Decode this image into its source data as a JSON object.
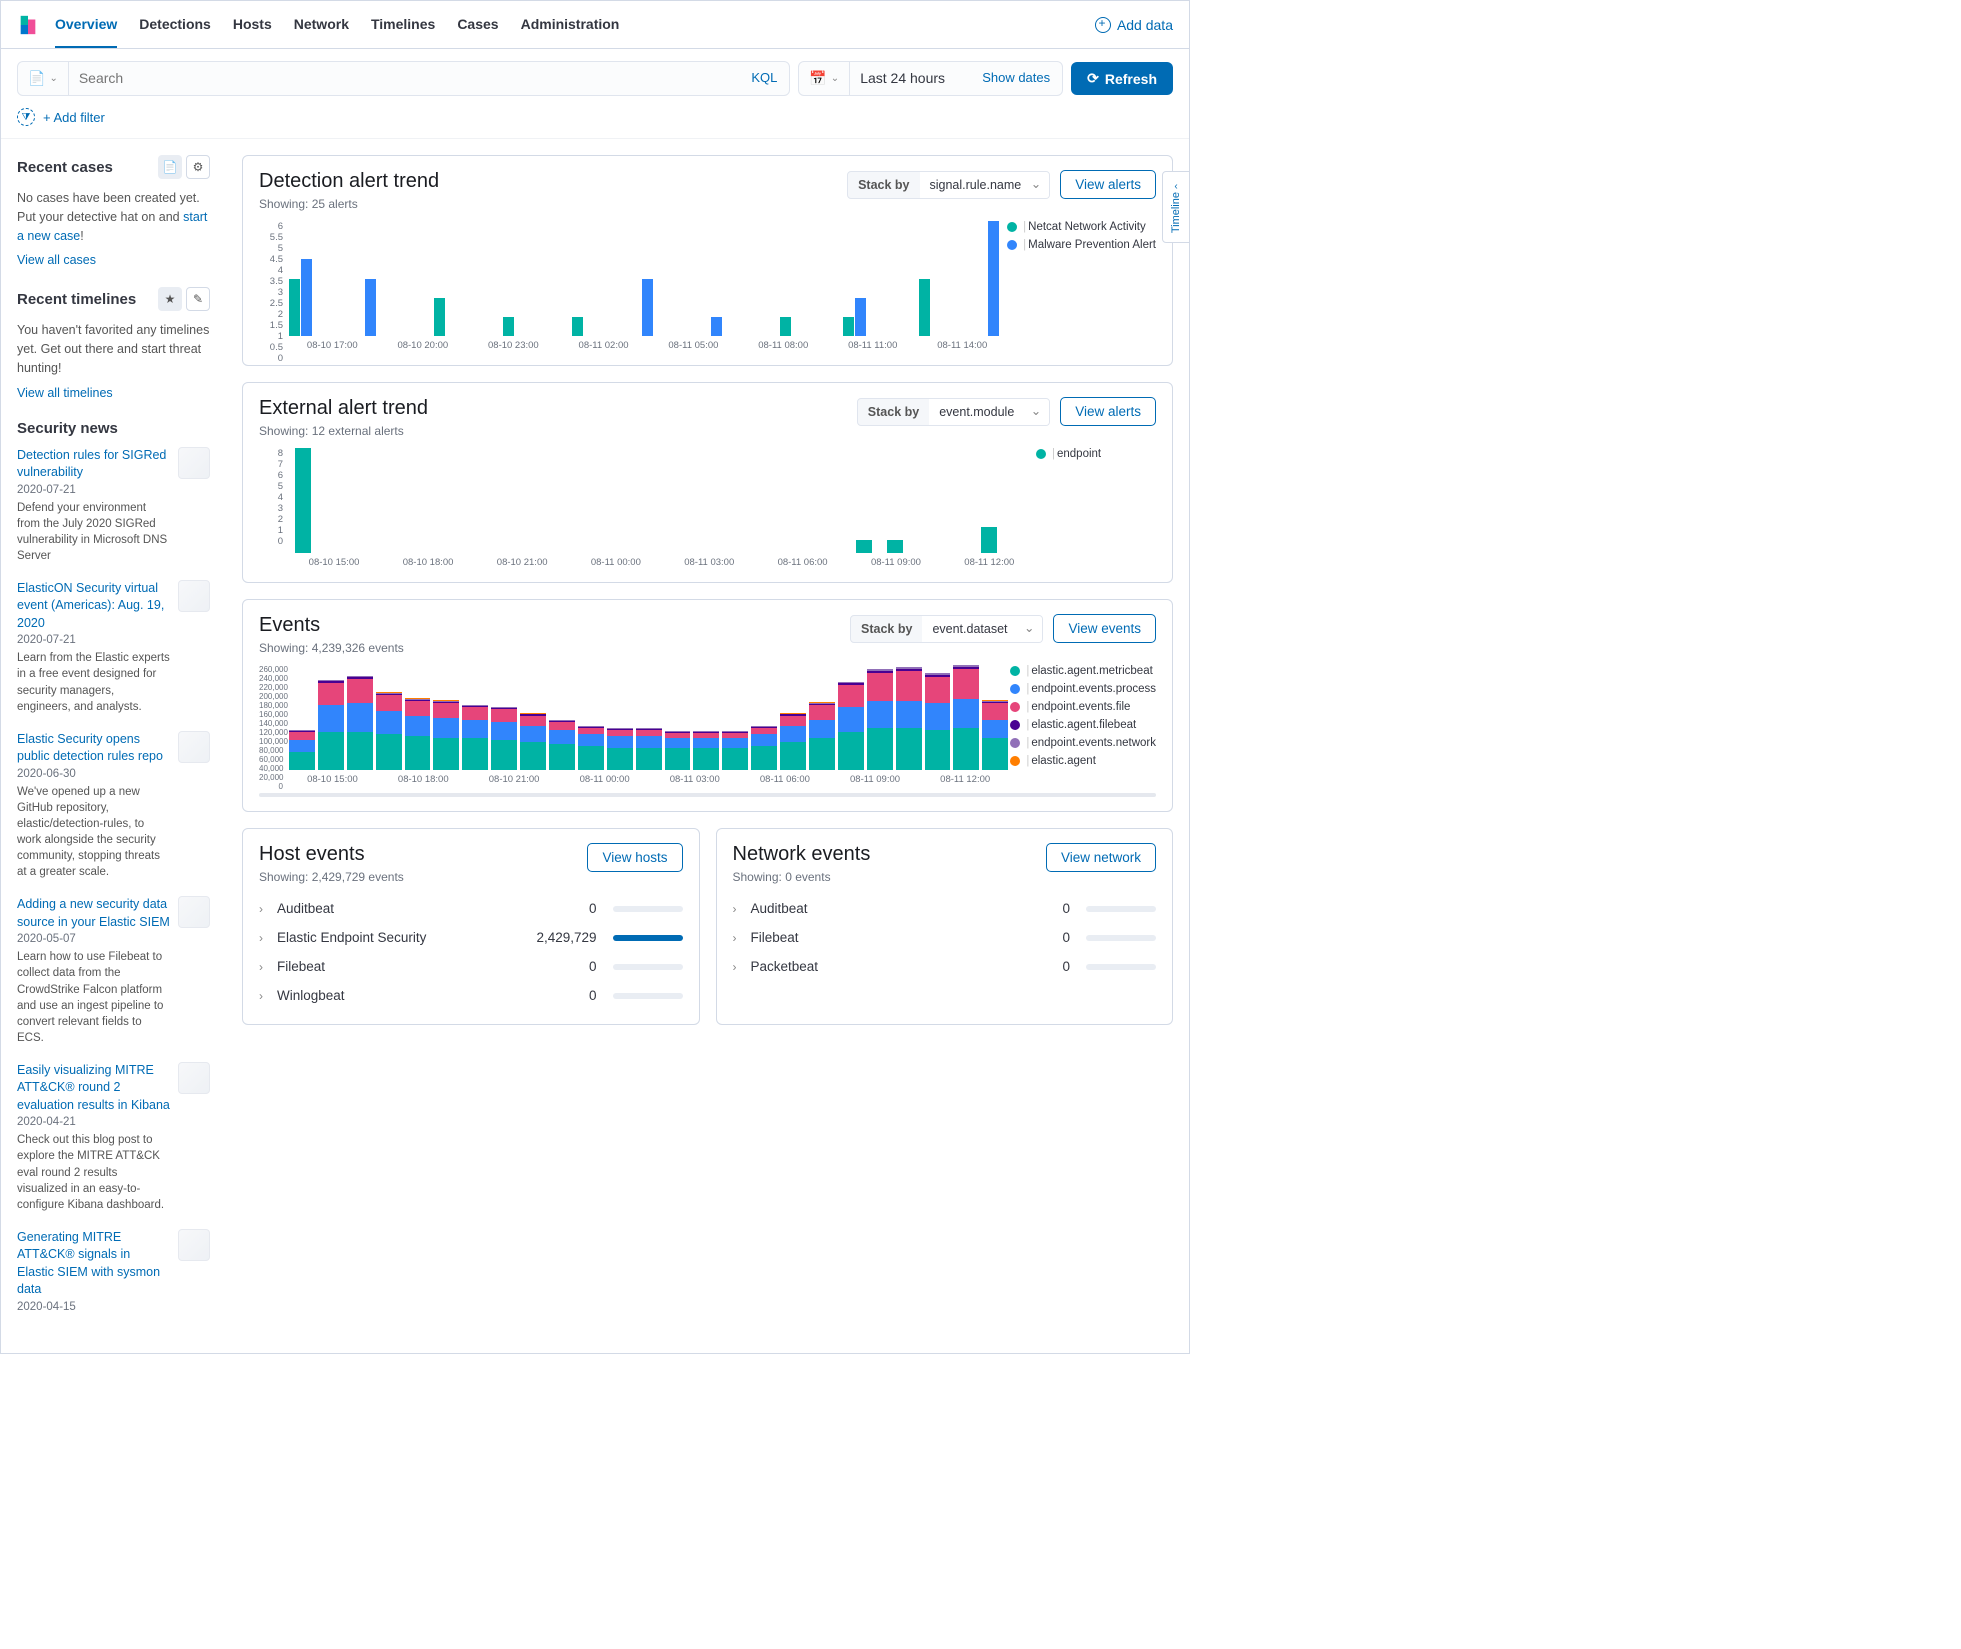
{
  "header": {
    "tabs": [
      "Overview",
      "Detections",
      "Hosts",
      "Network",
      "Timelines",
      "Cases",
      "Administration"
    ],
    "active_tab": "Overview",
    "add_data": "Add data"
  },
  "search": {
    "placeholder": "Search",
    "kql": "KQL",
    "time_range": "Last 24 hours",
    "show_dates": "Show dates",
    "refresh": "Refresh",
    "add_filter": "+ Add filter"
  },
  "sidebar": {
    "recent_cases": {
      "title": "Recent cases",
      "text_a": "No cases have been created yet. Put your detective hat on and ",
      "link": "start a new case",
      "bang": "!",
      "view_all": "View all cases"
    },
    "recent_timelines": {
      "title": "Recent timelines",
      "text": "You haven't favorited any timelines yet. Get out there and start threat hunting!",
      "view_all": "View all timelines"
    },
    "news": {
      "title": "Security news",
      "items": [
        {
          "title": "Detection rules for SIGRed vulnerability",
          "date": "2020-07-21",
          "desc": "Defend your environment from the July 2020 SIGRed vulnerability in Microsoft DNS Server"
        },
        {
          "title": "ElasticON Security virtual event (Americas): Aug. 19, 2020",
          "date": "2020-07-21",
          "desc": "Learn from the Elastic experts in a free event designed for security managers, engineers, and analysts."
        },
        {
          "title": "Elastic Security opens public detection rules repo",
          "date": "2020-06-30",
          "desc": "We've opened up a new GitHub repository, elastic/detection-rules, to work alongside the security community, stopping threats at a greater scale."
        },
        {
          "title": "Adding a new security data source in your Elastic SIEM",
          "date": "2020-05-07",
          "desc": "Learn how to use Filebeat to collect data from the CrowdStrike Falcon platform and use an ingest pipeline to convert relevant fields to ECS."
        },
        {
          "title": "Easily visualizing MITRE ATT&CK® round 2 evaluation results in Kibana",
          "date": "2020-04-21",
          "desc": "Check out this blog post to explore the MITRE ATT&CK eval round 2 results visualized in an easy-to-configure Kibana dashboard."
        },
        {
          "title": "Generating MITRE ATT&CK® signals in Elastic SIEM with sysmon data",
          "date": "2020-04-15",
          "desc": ""
        }
      ]
    }
  },
  "panels": {
    "detection": {
      "title": "Detection alert trend",
      "showing": "Showing: 25 alerts",
      "stack_by_label": "Stack by",
      "stack_by_value": "signal.rule.name",
      "button": "View alerts",
      "yticks": [
        "6",
        "5.5",
        "5",
        "4.5",
        "4",
        "3.5",
        "3",
        "2.5",
        "2",
        "1.5",
        "1",
        "0.5",
        "0"
      ],
      "xticks": [
        "08-10 17:00",
        "08-10 20:00",
        "08-10 23:00",
        "08-11 02:00",
        "08-11 05:00",
        "08-11 08:00",
        "08-11 11:00",
        "08-11 14:00"
      ],
      "legend": [
        "Netcat Network Activity",
        "Malware Prevention Alert"
      ]
    },
    "external": {
      "title": "External alert trend",
      "showing": "Showing: 12 external alerts",
      "stack_by_value": "event.module",
      "button": "View alerts",
      "yticks": [
        "8",
        "7",
        "6",
        "5",
        "4",
        "3",
        "2",
        "1",
        "0"
      ],
      "xticks": [
        "08-10 15:00",
        "08-10 18:00",
        "08-10 21:00",
        "08-11 00:00",
        "08-11 03:00",
        "08-11 06:00",
        "08-11 09:00",
        "08-11 12:00"
      ],
      "legend": [
        "endpoint"
      ]
    },
    "events": {
      "title": "Events",
      "showing": "Showing: 4,239,326 events",
      "stack_by_value": "event.dataset",
      "button": "View events",
      "yticks": [
        "260,000",
        "240,000",
        "220,000",
        "200,000",
        "180,000",
        "160,000",
        "140,000",
        "120,000",
        "100,000",
        "80,000",
        "60,000",
        "40,000",
        "20,000",
        "0"
      ],
      "xticks": [
        "08-10 15:00",
        "08-10 18:00",
        "08-10 21:00",
        "08-11 00:00",
        "08-11 03:00",
        "08-11 06:00",
        "08-11 09:00",
        "08-11 12:00"
      ],
      "legend": [
        "elastic.agent.metricbeat",
        "endpoint.events.process",
        "endpoint.events.file",
        "elastic.agent.filebeat",
        "endpoint.events.network",
        "elastic.agent"
      ]
    },
    "host_events": {
      "title": "Host events",
      "showing": "Showing: 2,429,729 events",
      "button": "View hosts",
      "rows": [
        {
          "name": "Auditbeat",
          "value": "0",
          "pct": 0
        },
        {
          "name": "Elastic Endpoint Security",
          "value": "2,429,729",
          "pct": 100
        },
        {
          "name": "Filebeat",
          "value": "0",
          "pct": 0
        },
        {
          "name": "Winlogbeat",
          "value": "0",
          "pct": 0
        }
      ]
    },
    "network_events": {
      "title": "Network events",
      "showing": "Showing: 0 events",
      "button": "View network",
      "rows": [
        {
          "name": "Auditbeat",
          "value": "0",
          "pct": 0
        },
        {
          "name": "Filebeat",
          "value": "0",
          "pct": 0
        },
        {
          "name": "Packetbeat",
          "value": "0",
          "pct": 0
        }
      ]
    }
  },
  "timeline_flyout": "Timeline",
  "chart_data": [
    {
      "type": "bar",
      "title": "Detection alert trend",
      "ylim": [
        0,
        6
      ],
      "legend_pos": "right",
      "categories": [
        "08-10 16:00",
        "08-10 17:00",
        "08-10 19:00",
        "08-10 20:00",
        "08-10 22:00",
        "08-11 05:00",
        "08-11 10:00",
        "08-11 11:00",
        "08-11 12:00",
        "08-11 13:00",
        "08-11 14:00"
      ],
      "series": [
        {
          "name": "Netcat Network Activity",
          "color": "#00b3a4",
          "values": [
            3,
            0,
            2,
            1,
            1,
            0,
            0,
            1,
            1,
            3,
            0
          ]
        },
        {
          "name": "Malware Prevention Alert",
          "color": "#3185fc",
          "values": [
            4,
            3,
            0,
            0,
            0,
            3,
            1,
            0,
            2,
            0,
            6
          ]
        }
      ]
    },
    {
      "type": "bar",
      "title": "External alert trend",
      "ylim": [
        0,
        8
      ],
      "legend_pos": "right",
      "categories": [
        "08-10 15:00",
        "08-11 09:00",
        "08-11 10:00",
        "08-11 12:00"
      ],
      "series": [
        {
          "name": "endpoint",
          "color": "#00b3a4",
          "values": [
            8,
            1,
            1,
            2
          ]
        }
      ]
    },
    {
      "type": "bar",
      "title": "Events",
      "ylim": [
        0,
        260000
      ],
      "legend_pos": "right",
      "stacked": true,
      "categories": [
        "08-10 14:00",
        "08-10 15:00",
        "08-10 16:00",
        "08-10 17:00",
        "08-10 18:00",
        "08-10 19:00",
        "08-10 20:00",
        "08-10 21:00",
        "08-10 22:00",
        "08-10 23:00",
        "08-11 00:00",
        "08-11 01:00",
        "08-11 02:00",
        "08-11 03:00",
        "08-11 04:00",
        "08-11 05:00",
        "08-11 06:00",
        "08-11 07:00",
        "08-11 08:00",
        "08-11 09:00",
        "08-11 10:00",
        "08-11 11:00",
        "08-11 12:00",
        "08-11 13:00",
        "08-11 14:00"
      ],
      "series": [
        {
          "name": "elastic.agent.metricbeat",
          "color": "#00b3a4",
          "values": [
            45000,
            95000,
            95000,
            90000,
            85000,
            80000,
            80000,
            75000,
            70000,
            65000,
            60000,
            55000,
            55000,
            55000,
            55000,
            55000,
            60000,
            70000,
            80000,
            95000,
            105000,
            105000,
            100000,
            105000,
            80000
          ]
        },
        {
          "name": "endpoint.events.process",
          "color": "#3185fc",
          "values": [
            30000,
            65000,
            70000,
            55000,
            50000,
            50000,
            45000,
            45000,
            40000,
            35000,
            30000,
            30000,
            30000,
            25000,
            25000,
            25000,
            30000,
            40000,
            45000,
            60000,
            65000,
            65000,
            65000,
            70000,
            45000
          ]
        },
        {
          "name": "endpoint.events.file",
          "color": "#e6457a",
          "values": [
            18000,
            55000,
            60000,
            40000,
            35000,
            35000,
            30000,
            30000,
            25000,
            20000,
            15000,
            15000,
            15000,
            12000,
            12000,
            12000,
            15000,
            25000,
            35000,
            55000,
            70000,
            75000,
            65000,
            75000,
            40000
          ]
        },
        {
          "name": "elastic.agent.filebeat",
          "color": "#490092",
          "values": [
            3000,
            5000,
            5000,
            4000,
            4000,
            4000,
            3000,
            3000,
            3000,
            2000,
            2000,
            2000,
            2000,
            2000,
            2000,
            2000,
            2000,
            3000,
            4000,
            5000,
            6000,
            6000,
            6000,
            6000,
            4000
          ]
        },
        {
          "name": "endpoint.events.network",
          "color": "#9170b8",
          "values": [
            2000,
            3000,
            3000,
            3000,
            3000,
            3000,
            2000,
            2000,
            2000,
            2000,
            2000,
            2000,
            2000,
            2000,
            2000,
            2000,
            2000,
            2000,
            3000,
            3000,
            4000,
            4000,
            4000,
            4000,
            3000
          ]
        },
        {
          "name": "elastic.agent",
          "color": "#ff7e00",
          "values": [
            500,
            500,
            500,
            500,
            500,
            500,
            500,
            500,
            500,
            500,
            500,
            500,
            500,
            500,
            500,
            500,
            500,
            500,
            500,
            500,
            500,
            500,
            500,
            500,
            500
          ]
        }
      ]
    }
  ]
}
